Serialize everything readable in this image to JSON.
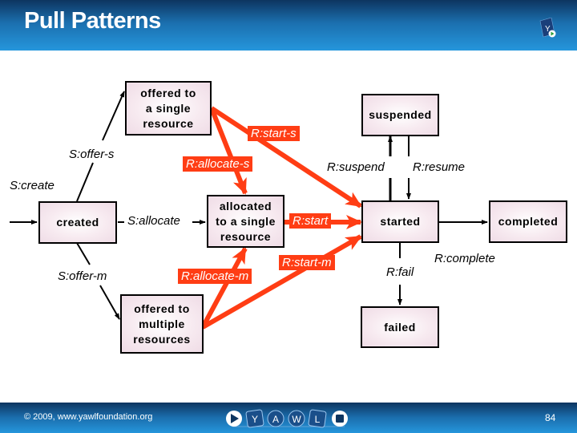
{
  "header": {
    "title": "Pull Patterns",
    "logo_icon": "yawl-corner-logo-icon"
  },
  "footer": {
    "copyright": "© 2009, www.yawlfoundation.org",
    "page_number": "84",
    "logo_letters": [
      "Y",
      "A",
      "W",
      "L"
    ]
  },
  "colors": {
    "resource_arrow": "#ff3d14",
    "system_arrow": "#000000",
    "header_blue": "#2596dc",
    "box_fill": "#f7eaf0"
  },
  "states": {
    "offered_single": "offered to\na single\nresource",
    "suspended": "suspended",
    "created": "created",
    "allocated_single": "allocated\nto a single\nresource",
    "started": "started",
    "completed": "completed",
    "offered_multiple": "offered to\nmultiple\nresources",
    "failed": "failed"
  },
  "system_transitions": {
    "create": "S:create",
    "offer_s": "S:offer-s",
    "offer_m": "S:offer-m",
    "allocate": "S:allocate"
  },
  "resource_transitions": {
    "start_s": "R:start-s",
    "allocate_s": "R:allocate-s",
    "allocate_m": "R:allocate-m",
    "start": "R:start",
    "start_m": "R:start-m",
    "suspend": "R:suspend",
    "resume": "R:resume",
    "complete": "R:complete",
    "fail": "R:fail"
  }
}
